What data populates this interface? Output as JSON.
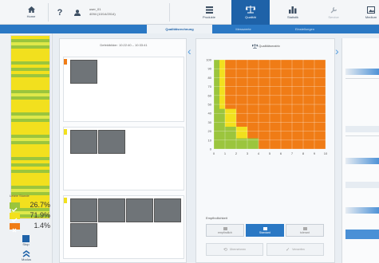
{
  "toolbar": {
    "home_label": "Home",
    "help_glyph": "?",
    "user_line1": "user_01",
    "user_line2": "4094 (10/14/2014)",
    "produkte_label": "Produkte",
    "qualitaet_label": "Qualität",
    "statistik_label": "Statistik",
    "service_label": "Service",
    "medium_label": "Medium"
  },
  "subnav": {
    "tab1": "Qualitätsrechnung",
    "tab2": "Messwerte",
    "tab3": "Einstellungen"
  },
  "sidebar": {
    "legend_title": "Letzte Stunde",
    "legend": [
      {
        "color": "#9bc53d",
        "value": "26.7%"
      },
      {
        "color": "#f2e01e",
        "value": "71.9%"
      },
      {
        "color": "#f07c16",
        "value": "1.4%"
      }
    ],
    "stop_label": "Stop",
    "modus_label": "Modus"
  },
  "gallery": {
    "header": "Defektbilder: 10:22:40 – 10:33:41"
  },
  "chart": {
    "title": "Qualitätsmatrix",
    "icon": "scale-icon"
  },
  "bottom": {
    "section_label": "Empfindlichkeit",
    "btn1": "empfindlich",
    "btn2": "Standard",
    "btn3": "tolerant",
    "action1": "Übernehmen",
    "action2": "Verwerfen"
  },
  "chart_data": {
    "type": "heatmap",
    "title": "Qualitätsmatrix",
    "xlabel": "",
    "ylabel": "",
    "x_ticks": [
      "0",
      "1",
      "2",
      "3",
      "4",
      "5",
      "6",
      "7",
      "8",
      "9",
      "10"
    ],
    "y_ticks": [
      "0",
      "10",
      "20",
      "30",
      "40",
      "50",
      "60",
      "70",
      "80",
      "90",
      "100"
    ],
    "colors": {
      "green": "#9bc53d",
      "yellow": "#f2e01e",
      "orange": "#f07c16"
    }
  }
}
